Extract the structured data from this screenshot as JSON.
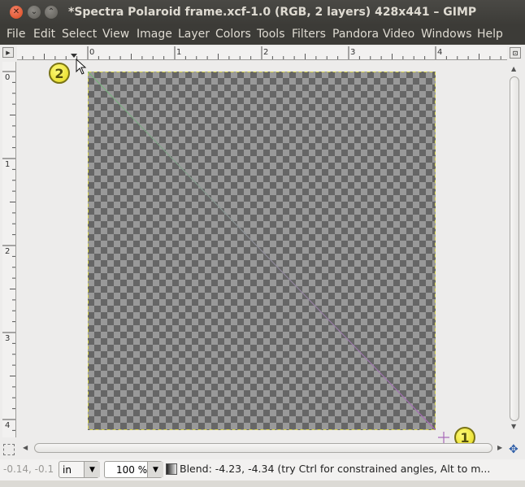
{
  "window": {
    "title": "*Spectra Polaroid frame.xcf-1.0 (RGB, 2 layers) 428x441 – GIMP",
    "buttons": [
      "close-icon",
      "minimize-icon",
      "maximize-icon"
    ]
  },
  "menubar": {
    "items": [
      "File",
      "Edit",
      "Select",
      "View",
      "Image",
      "Layer",
      "Colors",
      "Tools",
      "Filters",
      "Pandora",
      "Video",
      "Windows",
      "Help"
    ]
  },
  "rulers": {
    "horizontal_labels": [
      "0",
      "1",
      "2",
      "3",
      "4"
    ],
    "vertical_labels": [
      "0",
      "1",
      "2",
      "3",
      "4"
    ]
  },
  "canvas": {
    "image_width": 428,
    "image_height": 441,
    "background": "transparent-checkerboard",
    "blend_line_colors": [
      "#76b27a",
      "#a768b8"
    ]
  },
  "callouts": [
    "2",
    "1"
  ],
  "statusbar": {
    "coords": "-0.14, -0.1",
    "unit": "in",
    "zoom": "100 %",
    "message": "Blend: -4.23, -4.34 (try Ctrl for constrained angles, Alt to m..."
  },
  "colors": {
    "titlebar": "#3c3b37",
    "menu_text": "#dfdbd2",
    "close_button": "#e05a2b",
    "callout_fill": "#f2ea3a"
  }
}
